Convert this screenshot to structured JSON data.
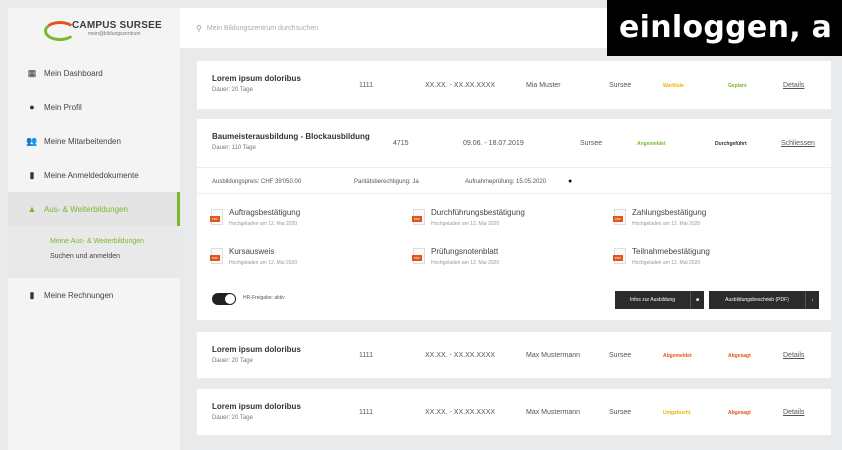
{
  "logo": {
    "title": "CAMPUS SURSEE",
    "sub": "mein@bildungszentrum"
  },
  "search": {
    "placeholder": "Mein Bildungszentrum durchsuchen"
  },
  "overlay_text": "einloggen, a",
  "sidebar": {
    "items": [
      {
        "label": "Mein Dashboard",
        "icon": "grid-icon"
      },
      {
        "label": "Mein Profil",
        "icon": "user-icon"
      },
      {
        "label": "Meine Mitarbeitenden",
        "icon": "users-icon"
      },
      {
        "label": "Meine Anmeldedokumente",
        "icon": "document-icon"
      },
      {
        "label": "Aus- & Weiterbildungen",
        "icon": "graduation-icon"
      },
      {
        "label": "Meine Rechnungen",
        "icon": "invoice-icon"
      }
    ],
    "sub_items": [
      "Meine Aus- & Weiterbildungen",
      "Suchen und anmelden"
    ]
  },
  "colors": {
    "accent": "#7cb82f",
    "warning": "#f0b400",
    "danger": "#e2541c",
    "dark": "#2b2b2b"
  },
  "cards": [
    {
      "title": "Lorem ipsum doloribus",
      "duration": "Dauer: 20 Tage",
      "number": "1111",
      "dates": "XX.XX. - XX.XX.XXXX",
      "person": "Mia Muster",
      "location": "Sursee",
      "status1": "Wartliste",
      "status2": "Geplant",
      "action": "Details"
    },
    {
      "title": "Lorem ipsum doloribus",
      "duration": "Dauer: 20 Tage",
      "number": "1111",
      "dates": "XX.XX. - XX.XX.XXXX",
      "person": "Max Mustermann",
      "location": "Sursee",
      "status1": "Abgemeldet",
      "status2": "Abgesagt",
      "action": "Details"
    },
    {
      "title": "Lorem ipsum doloribus",
      "duration": "Dauer: 20 Tage",
      "number": "1111",
      "dates": "XX.XX. - XX.XX.XXXX",
      "person": "Max Mustermann",
      "location": "Sursee",
      "status1": "Umgebucht",
      "status2": "Abgesagt",
      "action": "Details"
    }
  ],
  "expanded": {
    "title": "Baumeisterausbildung - Blockausbildung",
    "duration": "Dauer: 110 Tage",
    "number": "4715",
    "dates": "09.06. - 18.07.2019",
    "location": "Sursee",
    "status1": "Angemeldet",
    "status2": "Durchgeführt",
    "action": "Schliessen",
    "price": "Ausbildungspreis: CHF 39'050.00",
    "parity": "Paritätsberechtigung: Ja",
    "exam": "Aufnahmeprüfung: 15.05.2020",
    "documents": [
      {
        "name": "Auftragsbestätigung",
        "meta": "Hochgeladen am 12. Mai 2020"
      },
      {
        "name": "Durchführungsbestätigung",
        "meta": "Hochgeladen am 12. Mai 2020"
      },
      {
        "name": "Zahlungsbestätigung",
        "meta": "Hochgeladen am 12. Mai 2020"
      },
      {
        "name": "Kursausweis",
        "meta": "Hochgeladen am 12. Mai 2020"
      },
      {
        "name": "Prüfungsnotenblatt",
        "meta": "Hochgeladen am 12. Mai 2020"
      },
      {
        "name": "Teilnahmebestätigung",
        "meta": "Hochgeladen am 12. Mai 2020"
      }
    ],
    "toggle_label": "HR-Freigabe: aktiv",
    "btn_info": "Infos zur Ausbildung",
    "btn_pdf": "Ausbildungsbeschrieb (PDF)"
  }
}
